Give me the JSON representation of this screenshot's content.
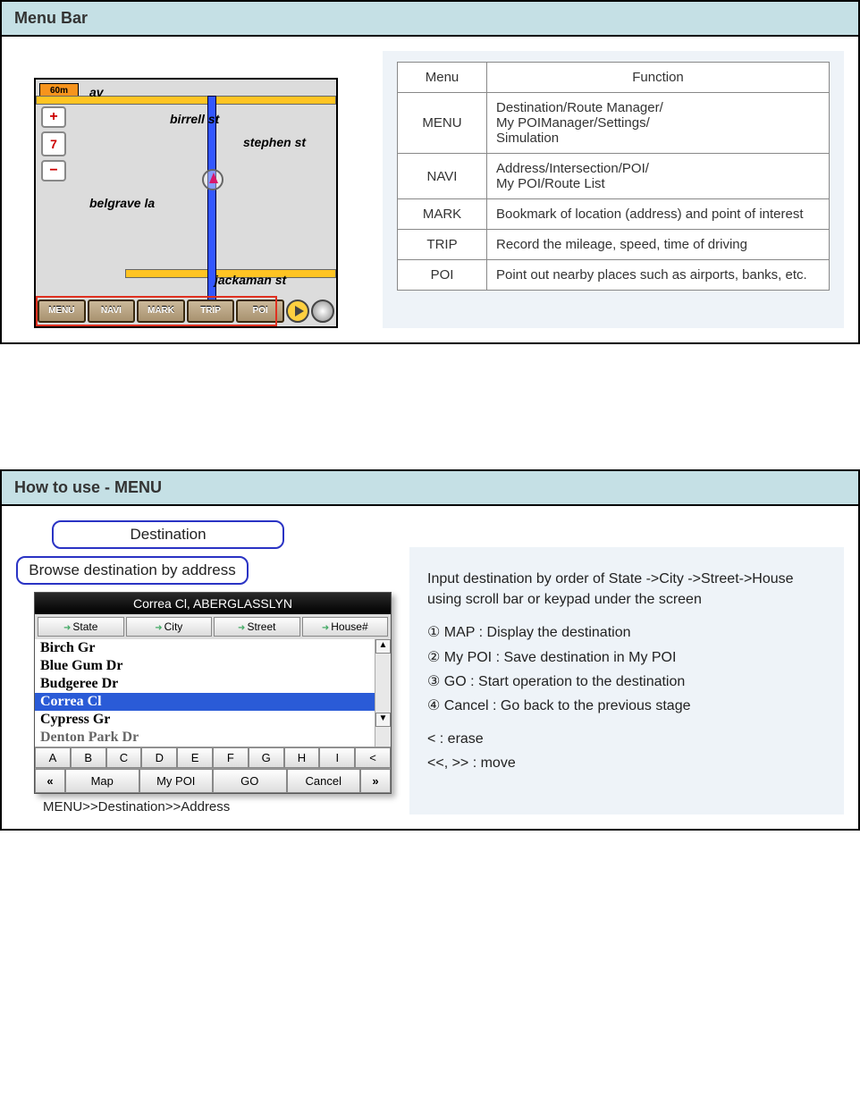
{
  "section1": {
    "title": "Menu Bar",
    "map": {
      "scale": "60m",
      "day": "7",
      "streets": {
        "top": "av",
        "birrell": "birrell st",
        "stephen": "stephen st",
        "belgrave": "belgrave la",
        "jackaman": "jackaman st"
      },
      "buttons": [
        "MENU",
        "NAVI",
        "MARK",
        "TRIP",
        "POI"
      ]
    },
    "table": {
      "headers": {
        "menu": "Menu",
        "function": "Function"
      },
      "rows": [
        {
          "menu": "MENU",
          "function": "Destination/Route Manager/\nMy POIManager/Settings/\nSimulation"
        },
        {
          "menu": "NAVI",
          "function": "Address/Intersection/POI/\nMy POI/Route List"
        },
        {
          "menu": "MARK",
          "function": "Bookmark of location (address) and point of interest"
        },
        {
          "menu": "TRIP",
          "function": "Record the mileage, speed, time of driving"
        },
        {
          "menu": "POI",
          "function": "Point out nearby places such as airports, banks, etc."
        }
      ]
    }
  },
  "section2": {
    "title": "How to use - MENU",
    "pill1": "Destination",
    "pill2": "Browse destination by address",
    "screen": {
      "title": "Correa Cl, ABERGLASSLYN",
      "tabs": [
        "State",
        "City",
        "Street",
        "House#"
      ],
      "list": [
        "Birch Gr",
        "Blue Gum Dr",
        "Budgeree Dr",
        "Correa Cl",
        "Cypress Gr",
        "Denton Park Dr"
      ],
      "selected_index": 3,
      "keys": [
        "A",
        "B",
        "C",
        "D",
        "E",
        "F",
        "G",
        "H",
        "I",
        "<"
      ],
      "bottom": [
        "«",
        "Map",
        "My POI",
        "GO",
        "Cancel",
        "»"
      ]
    },
    "caption": "MENU>>Destination>>Address",
    "notes": {
      "intro": "Input destination by order of State ->City ->Street->House using scroll bar or keypad under the screen",
      "n1": "① MAP : Display the destination",
      "n2": "② My POI : Save destination in My POI",
      "n3": "③ GO : Start operation to the destination",
      "n4": "④ Cancel : Go back to the previous stage",
      "e1": "< : erase",
      "e2": "<<, >> : move"
    }
  }
}
